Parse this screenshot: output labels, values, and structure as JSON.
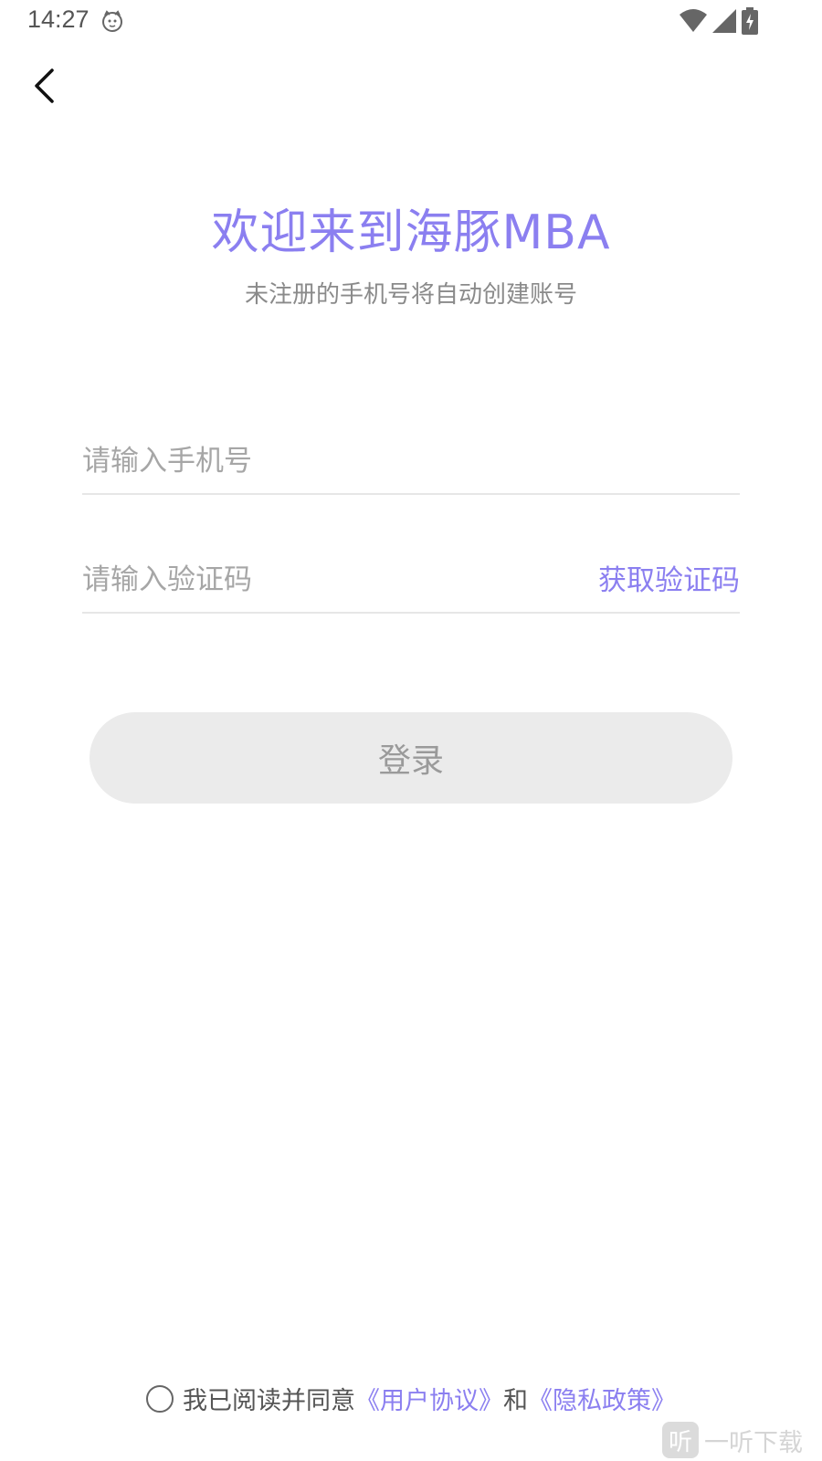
{
  "status_bar": {
    "time": "14:27",
    "icons": [
      "cat-notification-icon",
      "wifi-icon",
      "cell-signal-icon",
      "battery-charging-icon"
    ]
  },
  "header": {
    "back_icon": "chevron-left-icon"
  },
  "welcome": {
    "title": "欢迎来到海豚MBA",
    "subtitle": "未注册的手机号将自动创建账号"
  },
  "form": {
    "phone_placeholder": "请输入手机号",
    "phone_value": "",
    "code_placeholder": "请输入验证码",
    "code_value": "",
    "get_code_label": "获取验证码",
    "login_label": "登录"
  },
  "agreement": {
    "prefix": "我已阅读并同意",
    "user_agreement": "《用户协议》",
    "and": "和",
    "privacy_policy": "《隐私政策》",
    "checked": false
  },
  "watermark": {
    "logo_char": "听",
    "text": "一听下载"
  },
  "colors": {
    "accent": "#8b7ff0",
    "button_bg": "#ebebeb",
    "placeholder": "#a6a6a6",
    "divider": "#e6e6e6"
  }
}
